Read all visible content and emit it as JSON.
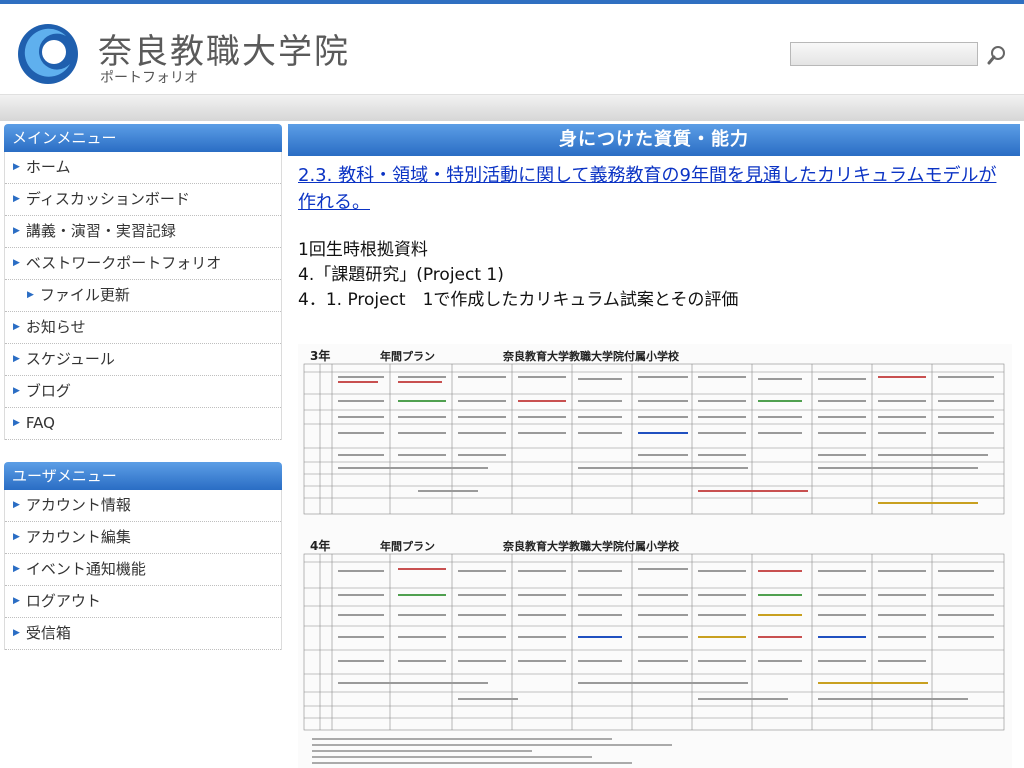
{
  "header": {
    "title": "奈良教職大学院",
    "subtitle": "ポートフォリオ",
    "search_placeholder": ""
  },
  "colors": {
    "accent": "#2a6dc4",
    "link": "#0b33c4"
  },
  "main_menu": {
    "title": "メインメニュー",
    "items": [
      {
        "label": "ホーム",
        "sub": false
      },
      {
        "label": "ディスカッションボード",
        "sub": false
      },
      {
        "label": "講義・演習・実習記録",
        "sub": false
      },
      {
        "label": "ベストワークポートフォリオ",
        "sub": false
      },
      {
        "label": "ファイル更新",
        "sub": true
      },
      {
        "label": "お知らせ",
        "sub": false
      },
      {
        "label": "スケジュール",
        "sub": false
      },
      {
        "label": "ブログ",
        "sub": false
      },
      {
        "label": "FAQ",
        "sub": false
      }
    ]
  },
  "user_menu": {
    "title": "ユーザメニュー",
    "items": [
      {
        "label": "アカウント情報"
      },
      {
        "label": "アカウント編集"
      },
      {
        "label": "イベント通知機能"
      },
      {
        "label": "ログアウト"
      },
      {
        "label": "受信箱"
      }
    ]
  },
  "main": {
    "heading": "身につけた資質・能力",
    "link_text": "2.3.  教科・領域・特別活動に関して義務教育の9年間を見通したカリキュラムモデルが作れる。",
    "line1": "1回生時根拠資料",
    "line2": "4.「課題研究」(Project 1)",
    "line3": "4．1. Project　1で作成したカリキュラム試案とその評価"
  },
  "document": {
    "table1_grade": "3年",
    "table1_plan": "年間プラン",
    "table1_school": "奈良教育大学教職大学院付属小学校",
    "table2_grade": "4年",
    "table2_plan": "年間プラン",
    "table2_school": "奈良教育大学教職大学院付属小学校"
  }
}
